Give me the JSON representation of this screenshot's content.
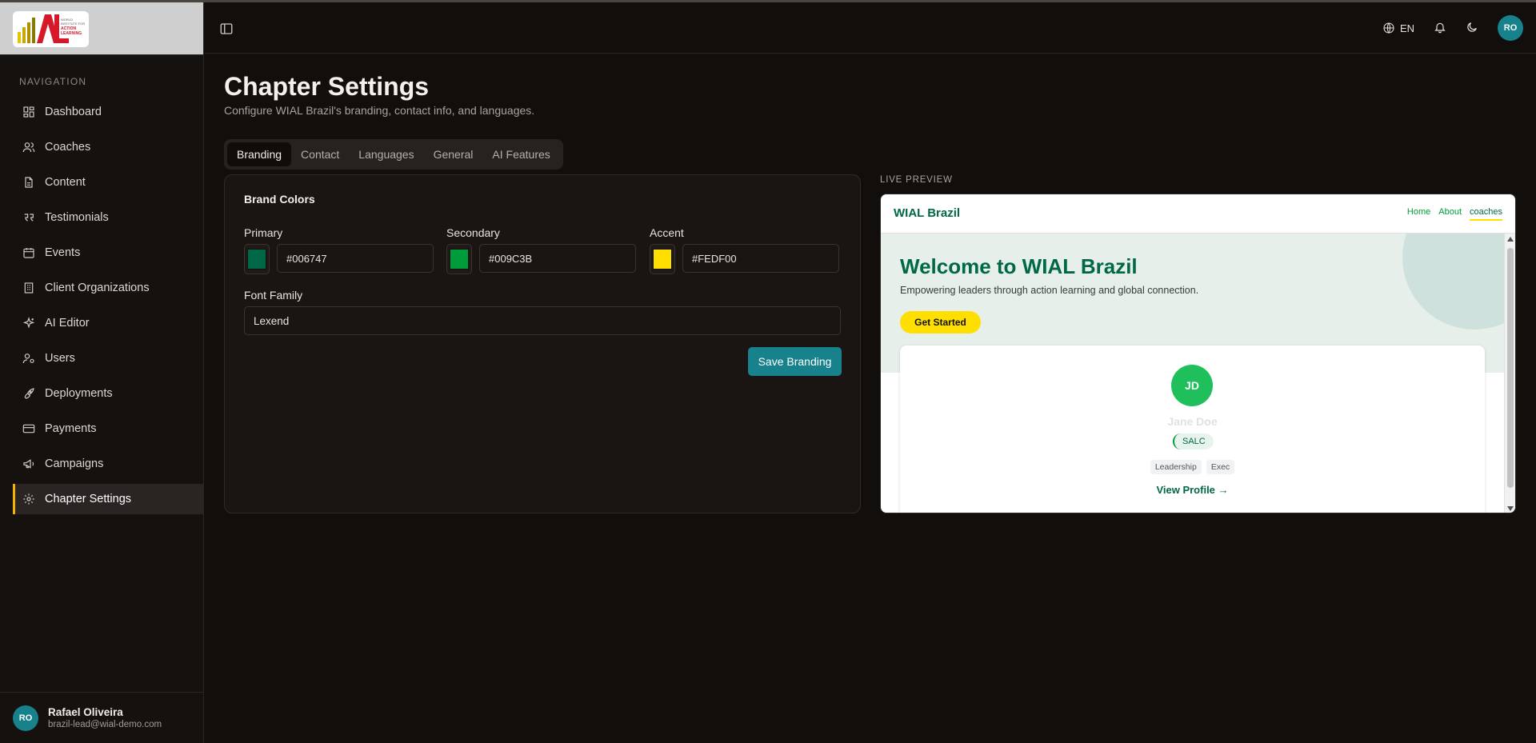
{
  "app": {
    "logo_alt": "World Institute for Action Learning"
  },
  "sidebar": {
    "heading": "NAVIGATION",
    "items": [
      {
        "label": "Dashboard",
        "icon": "dashboard-icon"
      },
      {
        "label": "Coaches",
        "icon": "users-icon"
      },
      {
        "label": "Content",
        "icon": "file-icon"
      },
      {
        "label": "Testimonials",
        "icon": "quote-icon"
      },
      {
        "label": "Events",
        "icon": "calendar-icon"
      },
      {
        "label": "Client Organizations",
        "icon": "building-icon"
      },
      {
        "label": "AI Editor",
        "icon": "sparkles-icon"
      },
      {
        "label": "Users",
        "icon": "user-cog-icon"
      },
      {
        "label": "Deployments",
        "icon": "rocket-icon"
      },
      {
        "label": "Payments",
        "icon": "credit-card-icon"
      },
      {
        "label": "Campaigns",
        "icon": "megaphone-icon"
      },
      {
        "label": "Chapter Settings",
        "icon": "gear-icon",
        "active": true
      }
    ],
    "user": {
      "initials": "RO",
      "name": "Rafael Oliveira",
      "email": "brazil-lead@wial-demo.com"
    }
  },
  "header": {
    "language": "EN",
    "avatar_initials": "RO"
  },
  "page": {
    "title": "Chapter Settings",
    "subtitle": "Configure WIAL Brazil's branding, contact info, and languages."
  },
  "tabs": [
    {
      "label": "Branding",
      "active": true
    },
    {
      "label": "Contact"
    },
    {
      "label": "Languages"
    },
    {
      "label": "General"
    },
    {
      "label": "AI Features"
    }
  ],
  "branding": {
    "section_title": "Brand Colors",
    "primary": {
      "label": "Primary",
      "value": "#006747",
      "color": "#006747"
    },
    "secondary": {
      "label": "Secondary",
      "value": "#009C3B",
      "color": "#009C3B"
    },
    "accent": {
      "label": "Accent",
      "value": "#FEDF00",
      "color": "#FEDF00"
    },
    "font_family": {
      "label": "Font Family",
      "value": "Lexend"
    },
    "save_label": "Save Branding"
  },
  "preview": {
    "label": "LIVE PREVIEW",
    "brand": "WIAL Brazil",
    "nav_links": [
      "Home",
      "About",
      "coaches"
    ],
    "hero_title": "Welcome to WIAL Brazil",
    "hero_subtitle": "Empowering leaders through action learning and global connection.",
    "cta_label": "Get Started",
    "coach": {
      "initials": "JD",
      "name": "Jane Doe",
      "badge": "SALC",
      "tags": [
        "Leadership",
        "Exec"
      ],
      "link_label": "View Profile →"
    }
  }
}
